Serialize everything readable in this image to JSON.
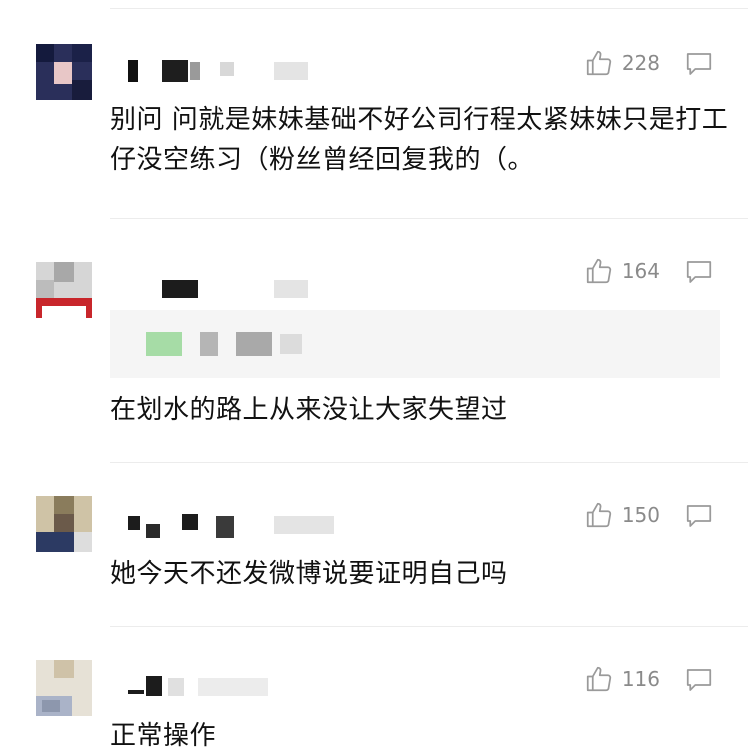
{
  "comments": [
    {
      "likes": "228",
      "text": "别问 问就是妹妹基础不好公司行程太紧妹妹只是打工仔没空练习（粉丝曾经回复我的（。"
    },
    {
      "likes": "164",
      "text": "在划水的路上从来没让大家失望过"
    },
    {
      "likes": "150",
      "text": "她今天不还发微博说要证明自己吗"
    },
    {
      "likes": "116",
      "text": "正常操作"
    }
  ],
  "icons": {
    "like": "thumbs-up-icon",
    "reply": "comment-icon"
  },
  "colors": {
    "meta_gray": "#8a8a8a",
    "divider": "#ececec",
    "text": "#111111"
  }
}
